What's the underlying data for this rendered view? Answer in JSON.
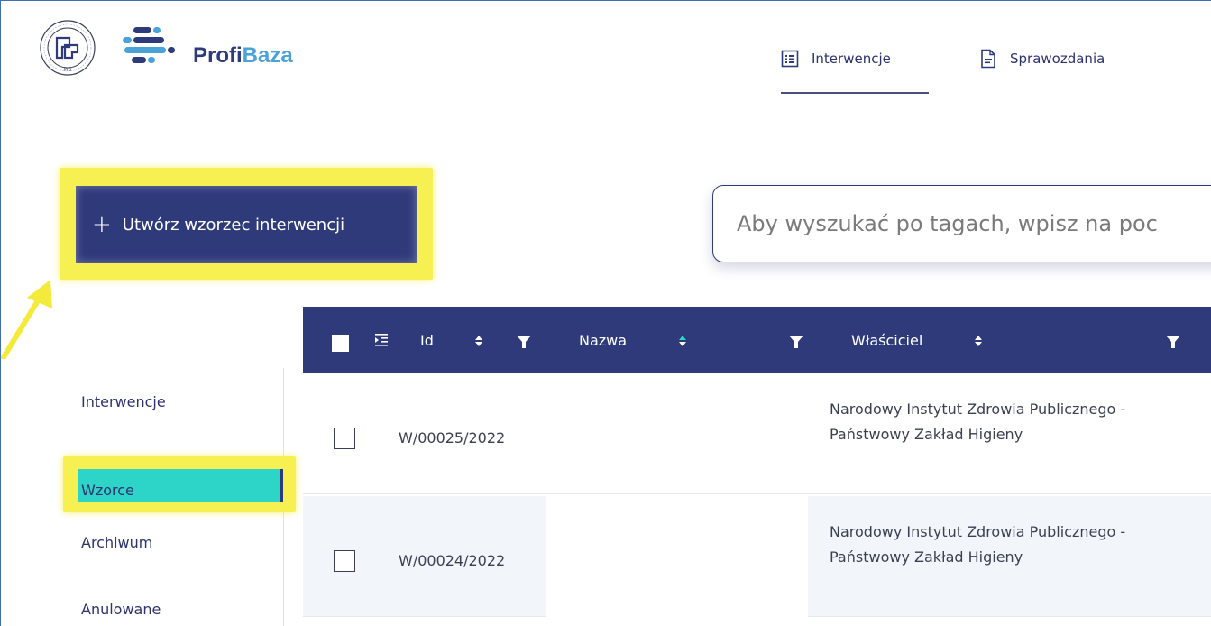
{
  "header": {
    "brand_part1": "Profi",
    "brand_part2": "Baza",
    "seal_caption": "PIB",
    "nav": [
      {
        "label": "Interwencje",
        "icon": "list-icon",
        "active": true
      },
      {
        "label": "Sprawozdania",
        "icon": "document-icon",
        "active": false
      }
    ]
  },
  "toolbar": {
    "create_label": "Utwórz wzorzec interwencji",
    "search_placeholder": "Aby wyszukać po tagach, wpisz na poc"
  },
  "sidebar": {
    "items": [
      {
        "label": "Interwencje",
        "active": false
      },
      {
        "label": "Wzorce",
        "active": true
      },
      {
        "label": "Archiwum",
        "active": false
      },
      {
        "label": "Anulowane",
        "active": false
      }
    ]
  },
  "table": {
    "columns": [
      {
        "label": "Id",
        "sortable": true,
        "filterable": true
      },
      {
        "label": "Nazwa",
        "sortable": true,
        "filterable": true
      },
      {
        "label": "Właściciel",
        "sortable": true,
        "filterable": true
      }
    ],
    "rows": [
      {
        "id": "W/00025/2022",
        "name": "",
        "owner": "Narodowy Instytut Zdrowia Publicznego - Państwowy Zakład Higieny"
      },
      {
        "id": "W/00024/2022",
        "name": "",
        "owner": "Narodowy Instytut Zdrowia Publicznego - Państwowy Zakład Higieny"
      }
    ]
  },
  "colors": {
    "primary": "#2f3a7b",
    "accent_teal": "#2dd4c8",
    "highlight_yellow": "#f7f052",
    "brand_light_blue": "#4aa3d8"
  }
}
